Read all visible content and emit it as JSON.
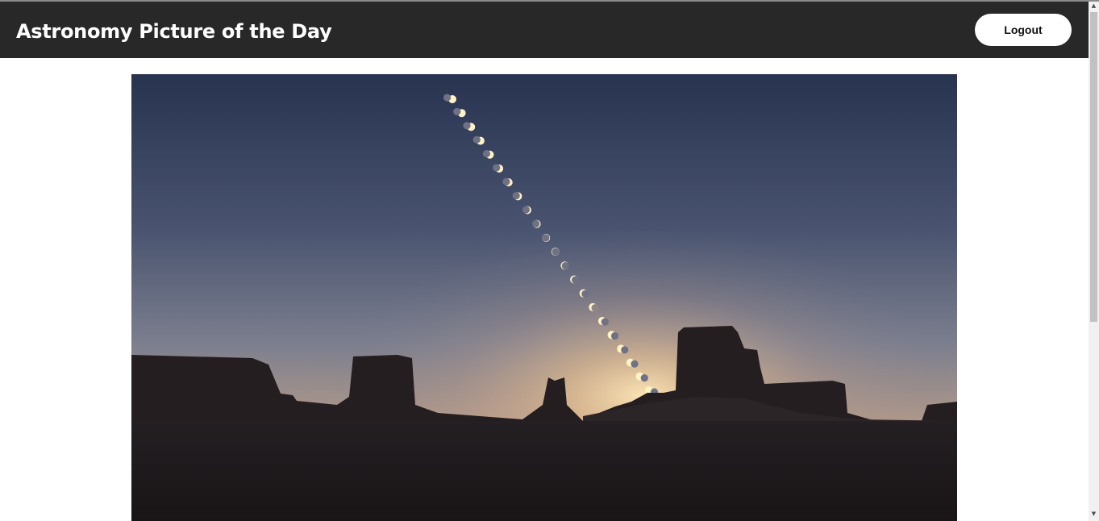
{
  "header": {
    "title": "Astronomy Picture of the Day",
    "logout_label": "Logout"
  },
  "apod": {
    "image_subject": "annular solar eclipse sequence over desert buttes at sunset"
  },
  "colors": {
    "header_bg": "#282828",
    "page_bg": "#ffffff",
    "button_bg": "#ffffff"
  }
}
